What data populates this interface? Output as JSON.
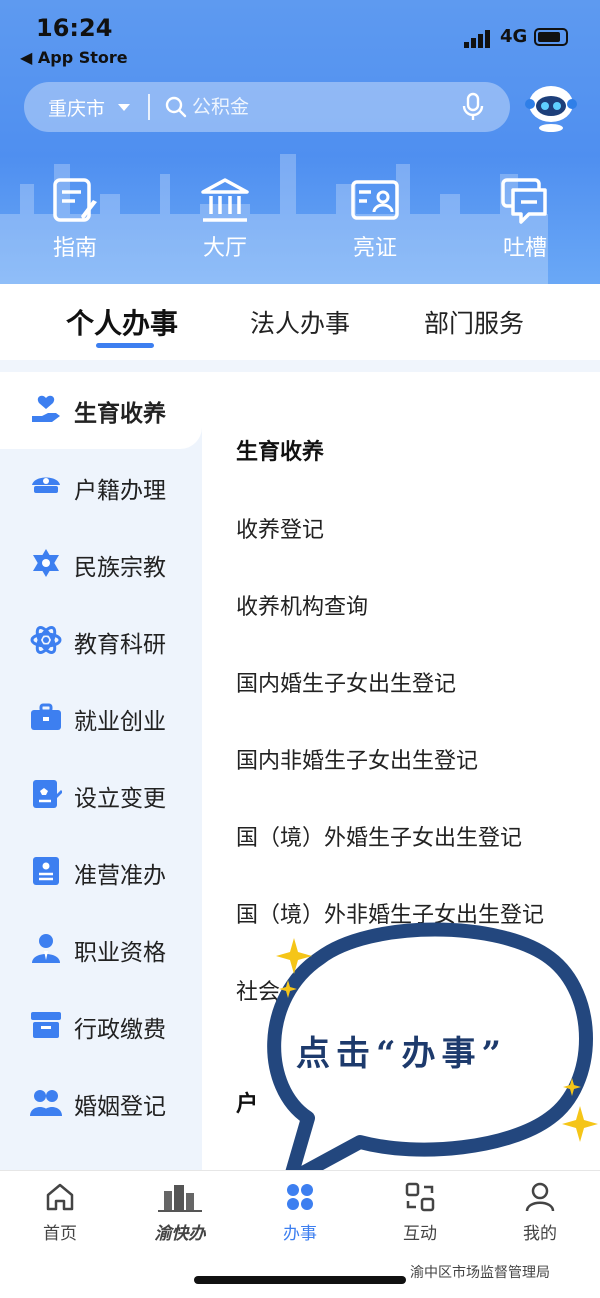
{
  "status": {
    "time": "16:24",
    "back_label": "◀ App Store",
    "network": "4G"
  },
  "search": {
    "city": "重庆市",
    "placeholder": "公积金"
  },
  "quick_links": [
    "指南",
    "大厅",
    "亮证",
    "吐槽"
  ],
  "tabs": [
    "个人办事",
    "法人办事",
    "部门服务"
  ],
  "sidebar": {
    "items": [
      "生育收养",
      "户籍办理",
      "民族宗教",
      "教育科研",
      "就业创业",
      "设立变更",
      "准营准办",
      "职业资格",
      "行政缴费",
      "婚姻登记"
    ]
  },
  "content": {
    "section_title": "生育收养",
    "items": [
      "收养登记",
      "收养机构查询",
      "国内婚生子女出生登记",
      "国内非婚生子女出生登记",
      "国（境）外婚生子女出生登记",
      "国（境）外非婚生子女出生登记",
      "社会"
    ],
    "next_section_fragment": "户"
  },
  "bubble": {
    "text": "点击“办事”"
  },
  "bottom_nav": [
    "首页",
    "渝快办",
    "办事",
    "互动",
    "我的"
  ],
  "watermark": "渝中区市场监督管理局",
  "colors": {
    "accent": "#3d7ff0",
    "header": "#5e9af0",
    "sidebar_bg": "#eef4fc",
    "bubble_stroke": "#23477e",
    "star": "#f5c518"
  }
}
